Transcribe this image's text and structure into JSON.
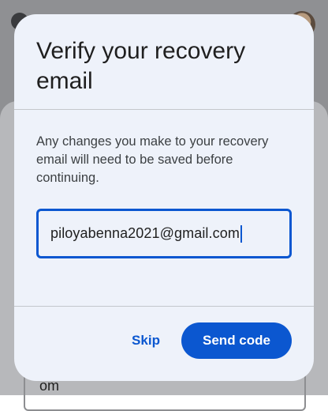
{
  "background": {
    "field_text": "om"
  },
  "dialog": {
    "title": "Verify your recovery email",
    "description": "Any changes you make to your recovery email will need to be saved before continuing.",
    "email_value": "piloyabenna2021@gmail.com",
    "skip_label": "Skip",
    "send_label": "Send code"
  },
  "colors": {
    "accent": "#0b57d0",
    "dialog_bg": "#eef2fa"
  }
}
